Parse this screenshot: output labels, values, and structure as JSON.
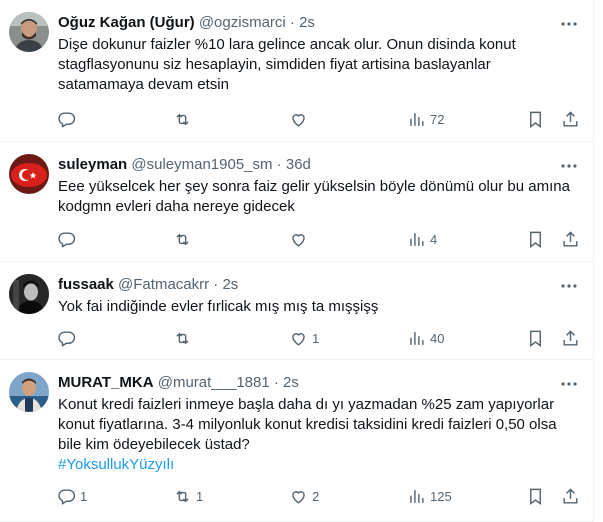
{
  "tweets": [
    {
      "name": "Oğuz Kağan (Uğur)",
      "handle": "@ogzismarci",
      "time": "2s",
      "text": "Dişe dokunur faizler %10 lara gelince ancak olur. Onun disinda konut stagflasyonunu siz hesaplayin, simdiden fiyat artisina baslayanlar satamamaya devam etsin",
      "hashtag": "",
      "replies": "",
      "retweets": "",
      "likes": "",
      "views": "72"
    },
    {
      "name": "suleyman",
      "handle": "@suleyman1905_sm",
      "time": "36d",
      "text": "Eee yükselcek her şey sonra faiz gelir yükselsin böyle dönümü olur bu amına kodgmn evleri daha nereye gidecek",
      "hashtag": "",
      "replies": "",
      "retweets": "",
      "likes": "",
      "views": "4"
    },
    {
      "name": "fussaak",
      "handle": "@Fatmacakrr",
      "time": "2s",
      "text": "Yok fai indiğinde evler fırlicak mış mış ta mışşişş",
      "hashtag": "",
      "replies": "",
      "retweets": "",
      "likes": "1",
      "views": "40"
    },
    {
      "name": "MURAT_MKA",
      "handle": "@murat___1881",
      "time": "2s",
      "text": "Konut kredi faizleri inmeye başla daha dı yı yazmadan %25 zam yapıyorlar konut fiyatlarına. 3-4 milyonluk konut kredisi taksidini kredi faizleri 0,50 olsa bile kim ödeyebilecek üstad?",
      "hashtag": "#YoksullukYüzyılı",
      "replies": "1",
      "retweets": "1",
      "likes": "2",
      "views": "125"
    }
  ],
  "separator": "·",
  "icons": [
    "more-icon",
    "reply-icon",
    "retweet-icon",
    "like-icon",
    "views-icon",
    "bookmark-icon",
    "share-icon"
  ],
  "colors": {
    "text": "#0f1419",
    "muted": "#536471",
    "link": "#1d9bf0",
    "divider": "#eff3f4"
  }
}
